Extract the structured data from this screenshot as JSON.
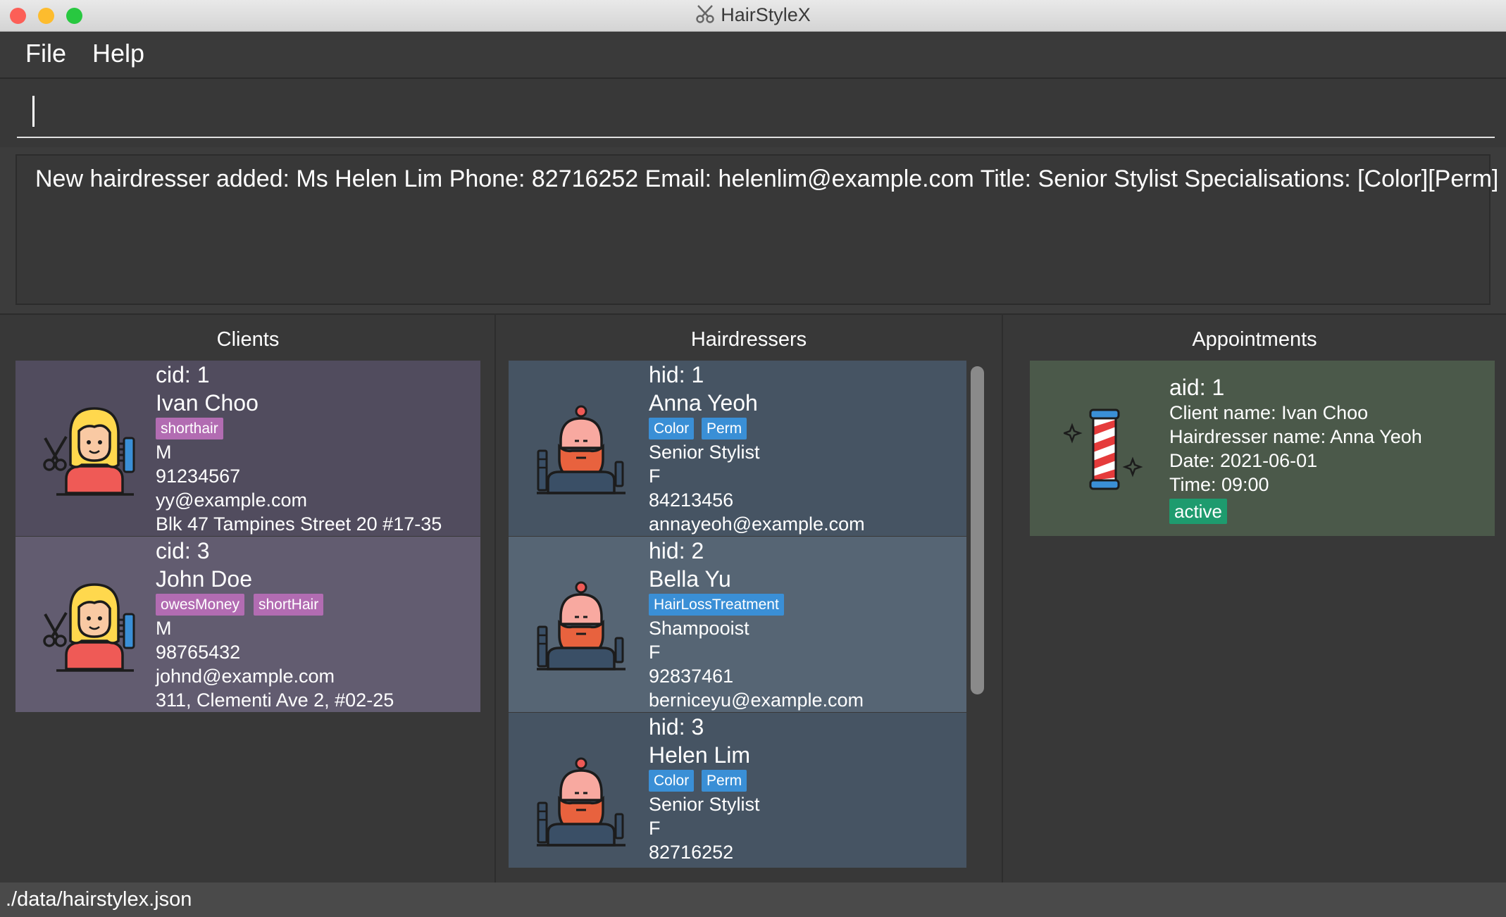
{
  "window": {
    "title": "HairStyleX",
    "traffic_lights": {
      "close": "#fc5f57",
      "minimize": "#fdbc2e",
      "maximize": "#28c840"
    }
  },
  "menu": {
    "file": "File",
    "help": "Help"
  },
  "command": {
    "value": "",
    "placeholder": ""
  },
  "result": {
    "message": "New hairdresser added: Ms Helen Lim Phone: 82716252 Email: helenlim@example.com Title: Senior Stylist Specialisations: [Color][Perm]"
  },
  "panels": {
    "clients": "Clients",
    "hairdressers": "Hairdressers",
    "appointments": "Appointments"
  },
  "clients": [
    {
      "id": "cid: 1",
      "name": "Ivan Choo",
      "tags": [
        "shorthair"
      ],
      "gender": "M",
      "phone": "91234567",
      "email": "yy@example.com",
      "address": "Blk 47 Tampines Street 20 #17-35"
    },
    {
      "id": "cid: 3",
      "name": "John Doe",
      "tags": [
        "owesMoney",
        "shortHair"
      ],
      "gender": "M",
      "phone": "98765432",
      "email": "johnd@example.com",
      "address": "311, Clementi Ave 2, #02-25"
    }
  ],
  "hairdressers": [
    {
      "id": "hid: 1",
      "name": "Anna Yeoh",
      "tags": [
        "Color",
        "Perm"
      ],
      "title": "Senior Stylist",
      "gender": "F",
      "phone": "84213456",
      "email": "annayeoh@example.com"
    },
    {
      "id": "hid: 2",
      "name": "Bella Yu",
      "tags": [
        "HairLossTreatment"
      ],
      "title": "Shampooist",
      "gender": "F",
      "phone": "92837461",
      "email": "berniceyu@example.com"
    },
    {
      "id": "hid: 3",
      "name": "Helen Lim",
      "tags": [
        "Color",
        "Perm"
      ],
      "title": "Senior Stylist",
      "gender": "F",
      "phone": "82716252"
    }
  ],
  "appointments": [
    {
      "id": "aid: 1",
      "client": "Client name:  Ivan Choo",
      "hairdresser": "Hairdresser name: Anna Yeoh",
      "date": "Date: 2021-06-01",
      "time": "Time: 09:00",
      "status": "active"
    }
  ],
  "status": {
    "path": "./data/hairstylex.json"
  },
  "colors": {
    "client_card_1": "#514c5e",
    "client_card_2": "#625c70",
    "hairdresser_card_1": "#465463",
    "hairdresser_card_2": "#566574",
    "appointment_card": "#4b594a",
    "client_tag": "#b26cb2",
    "hairdresser_tag": "#3a8fd6",
    "status_tag": "#1e9b6e"
  },
  "icons": {
    "title": "scissors-icon",
    "client_avatar": "hairdresser-woman-icon",
    "hairdresser_avatar": "bearded-barber-icon",
    "appointment": "barber-pole-icon"
  }
}
